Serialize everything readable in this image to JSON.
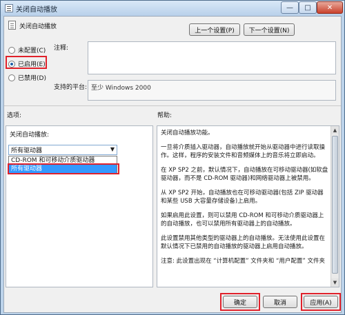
{
  "window": {
    "title": "关闭自动播放",
    "minimize_glyph": "—",
    "maximize_glyph": "□",
    "close_glyph": "✕"
  },
  "header": {
    "policy_name": "关闭自动播放",
    "prev_setting": "上一个设置(P)",
    "next_setting": "下一个设置(N)"
  },
  "state": {
    "options": [
      {
        "label": "未配置(C)",
        "checked": false
      },
      {
        "label": "已启用(E)",
        "checked": true
      },
      {
        "label": "已禁用(D)",
        "checked": false
      }
    ]
  },
  "comment": {
    "label": "注释:",
    "value": ""
  },
  "platform": {
    "label": "支持的平台:",
    "value": "至少 Windows 2000"
  },
  "sections": {
    "options_label": "选项:",
    "help_label": "帮助:"
  },
  "options_panel": {
    "field_label": "关闭自动播放:",
    "selected_value": "所有驱动器",
    "dropdown_items": [
      {
        "label": "CD-ROM 和可移动介质驱动器",
        "selected": false
      },
      {
        "label": "所有驱动器",
        "selected": true
      }
    ]
  },
  "help": {
    "paragraphs": [
      "关闭自动播放功能。",
      "一旦将介质插入驱动器，自动播放就开始从驱动器中进行读取操作。这样，程序的安装文件和音频媒体上的音乐将立即启动。",
      "在 XP SP2 之前，默认情况下，自动播放在可移动驱动器(如软盘驱动器，而不是 CD-ROM 驱动器)和网络驱动器上被禁用。",
      "从 XP SP2 开始，自动播放也在可移动驱动器(包括 ZIP 驱动器和某些 USB 大容量存储设备)上启用。",
      "如果启用此设置，则可以禁用 CD-ROM 和可移动介质驱动器上的自动播放，也可以禁用所有驱动器上的自动播放。",
      "此设置禁用其他类型的驱动器上的自动播放。无法使用此设置在默认情况下已禁用的自动播放的驱动器上启用自动播放。",
      "注意: 此设置出现在 “计算机配置” 文件夹和 “用户配置” 文件夹"
    ]
  },
  "footer": {
    "ok": "确定",
    "cancel": "取消",
    "apply": "应用(A)"
  },
  "colors": {
    "highlight_box": "#e0202a",
    "selection": "#3399ff"
  }
}
